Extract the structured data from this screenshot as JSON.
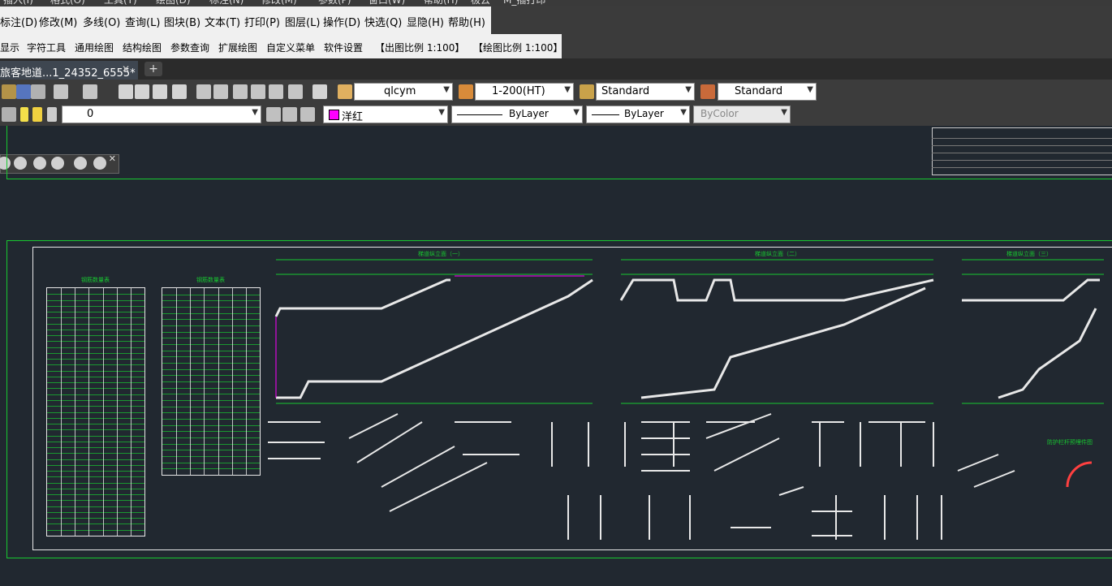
{
  "top_menu": [
    "插入(I)",
    "格式(O)",
    "工具(T)",
    "绘图(D)",
    "标注(N)",
    "修改(M)",
    "参数(P)",
    "窗口(W)",
    "帮助(H)",
    "极云",
    "M_插打印"
  ],
  "menu_row1": [
    "标注(D)",
    "修改(M)",
    "多线(O)",
    "查询(L)",
    "图块(B)",
    "文本(T)",
    "打印(P)",
    "图层(L)",
    "操作(D)",
    "快选(Q)",
    "显隐(H)",
    "帮助(H)"
  ],
  "menu_row2": [
    "显示",
    "字符工具",
    "通用绘图",
    "结构绘图",
    "参数查询",
    "扩展绘图",
    "自定义菜单",
    "软件设置",
    "【出图比例 1:100】",
    "【绘图比例 1:100】"
  ],
  "doc_tab": {
    "title": "旅客地道...1_24352_6555*",
    "close": "✕",
    "new": "+"
  },
  "toolbar": {
    "text_style": "qlcym",
    "dim_style": "1-200(HT)",
    "table_style": "Standard",
    "multileader_style": "Standard"
  },
  "layer_bar": {
    "layer": "0",
    "color": "洋红",
    "linetype": "ByLayer",
    "lineweight": "ByLayer",
    "plotstyle": "ByColor",
    "color_swatch": "#ff00ff"
  },
  "drawing": {
    "sections": [
      "梯道纵立面（一）",
      "梯道纵立面（二）",
      "梯道纵立面（三）"
    ],
    "tables": [
      "钢筋数量表",
      "钢筋数量表"
    ],
    "detail_label": "防护栏杆预埋件图"
  },
  "colors": {
    "accent_green": "#18c830",
    "canvas": "#212830",
    "magenta": "#ff00ff"
  }
}
